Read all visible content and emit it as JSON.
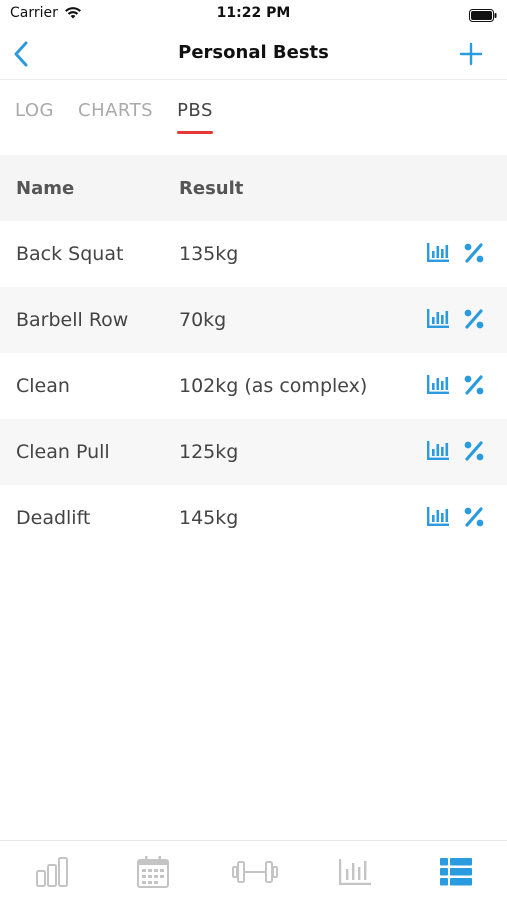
{
  "status": {
    "carrier": "Carrier",
    "time": "11:22 PM",
    "wifi_icon": "wifi-icon",
    "battery_icon": "battery-icon"
  },
  "header": {
    "title": "Personal Bests",
    "back_icon": "chevron-left-icon",
    "add_icon": "plus-icon"
  },
  "tabs": [
    {
      "label": "LOG",
      "active": false
    },
    {
      "label": "CHARTS",
      "active": false
    },
    {
      "label": "PBS",
      "active": true
    }
  ],
  "table": {
    "headers": {
      "name": "Name",
      "result": "Result"
    },
    "rows": [
      {
        "name": "Back Squat",
        "result": "135kg"
      },
      {
        "name": "Barbell Row",
        "result": "70kg"
      },
      {
        "name": "Clean",
        "result": "102kg (as complex)"
      },
      {
        "name": "Clean Pull",
        "result": "125kg"
      },
      {
        "name": "Deadlift",
        "result": "145kg"
      }
    ]
  },
  "bottom_nav": [
    {
      "icon": "bar-chart-outline-icon",
      "active": false
    },
    {
      "icon": "calendar-icon",
      "active": false
    },
    {
      "icon": "dumbbell-icon",
      "active": false
    },
    {
      "icon": "stats-chart-icon",
      "active": false
    },
    {
      "icon": "list-icon",
      "active": true
    }
  ],
  "colors": {
    "accent": "#2b9be0",
    "tab_underline": "#e53935",
    "inactive_icon": "#c4c4c4"
  }
}
